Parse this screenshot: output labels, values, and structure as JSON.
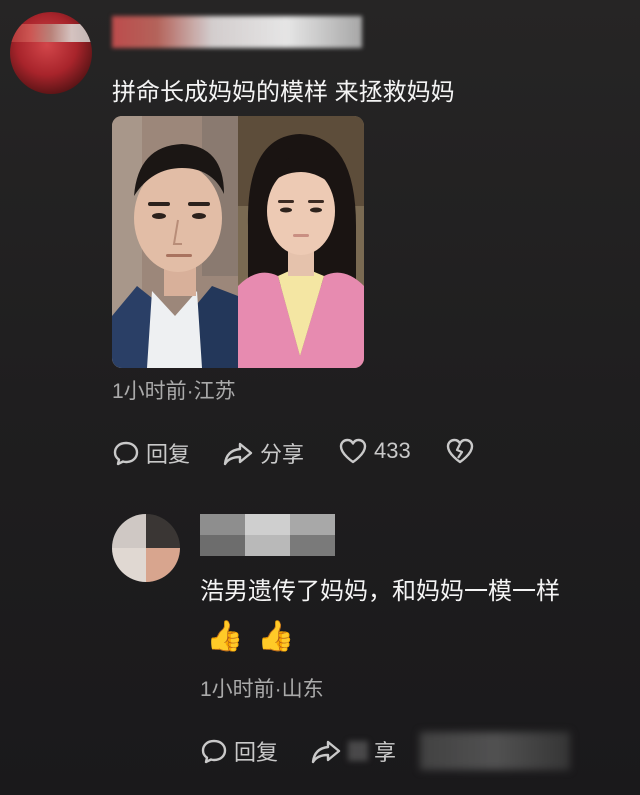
{
  "comment": {
    "text": "拼命长成妈妈的模样 来拯救妈妈",
    "meta": "1小时前·江苏",
    "actions": {
      "reply": "回复",
      "share": "分享",
      "like_count": "433"
    }
  },
  "reply": {
    "text": "浩男遗传了妈妈，和妈妈一模一样",
    "emoji": [
      "👍",
      "👍"
    ],
    "meta": "1小时前·山东",
    "actions": {
      "reply": "回复",
      "share": "享"
    }
  },
  "icons": {
    "reply": "comment-bubble-icon",
    "share": "share-arrow-icon",
    "like": "heart-outline-icon",
    "dislike": "broken-heart-icon"
  },
  "colors": {
    "background": "#222122",
    "text_primary": "#f4f4f4",
    "text_secondary": "#aaaaaa",
    "action_text": "#c9c9c9"
  }
}
